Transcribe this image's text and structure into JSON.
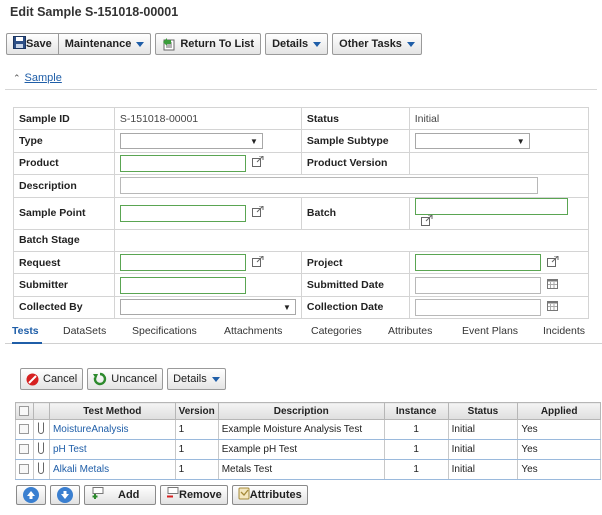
{
  "page": {
    "title": "Edit Sample S-151018-00001"
  },
  "toolbar": {
    "save": "Save",
    "maintenance": "Maintenance",
    "return_to_list": "Return To List",
    "details": "Details",
    "other_tasks": "Other Tasks"
  },
  "section": {
    "label": "Sample"
  },
  "form": {
    "sample_id_label": "Sample ID",
    "sample_id_value": "S-151018-00001",
    "status_label": "Status",
    "status_value": "Initial",
    "type_label": "Type",
    "sample_subtype_label": "Sample Subtype",
    "product_label": "Product",
    "product_version_label": "Product Version",
    "description_label": "Description",
    "sample_point_label": "Sample Point",
    "batch_label": "Batch",
    "batch_stage_label": "Batch Stage",
    "request_label": "Request",
    "project_label": "Project",
    "submitter_label": "Submitter",
    "submitted_date_label": "Submitted Date",
    "collected_by_label": "Collected By",
    "collection_date_label": "Collection Date"
  },
  "tabs": [
    "Tests",
    "DataSets",
    "Specifications",
    "Attachments",
    "Categories",
    "Attributes",
    "Event Plans",
    "Incidents"
  ],
  "tests_toolbar": {
    "cancel": "Cancel",
    "uncancel": "Uncancel",
    "details": "Details"
  },
  "tests_table": {
    "columns": [
      "Test Method",
      "Version",
      "Description",
      "Instance",
      "Status",
      "Applied"
    ],
    "rows": [
      {
        "test_method": "MoistureAnalysis",
        "version": "1",
        "description": "Example Moisture Analysis Test",
        "instance": "1",
        "status": "Initial",
        "applied": "Yes"
      },
      {
        "test_method": "pH Test",
        "version": "1",
        "description": "Example pH Test",
        "instance": "1",
        "status": "Initial",
        "applied": "Yes"
      },
      {
        "test_method": "Alkali Metals",
        "version": "1",
        "description": "Metals Test",
        "instance": "1",
        "status": "Initial",
        "applied": "Yes"
      }
    ]
  },
  "bottom_toolbar": {
    "add": "Add",
    "remove": "Remove",
    "attributes": "Attributes"
  },
  "colors": {
    "accent": "#1f5ea8",
    "valid_border": "#5aa552",
    "cancel_red": "#d62020",
    "uncancel_blue": "#2b6cc4"
  }
}
